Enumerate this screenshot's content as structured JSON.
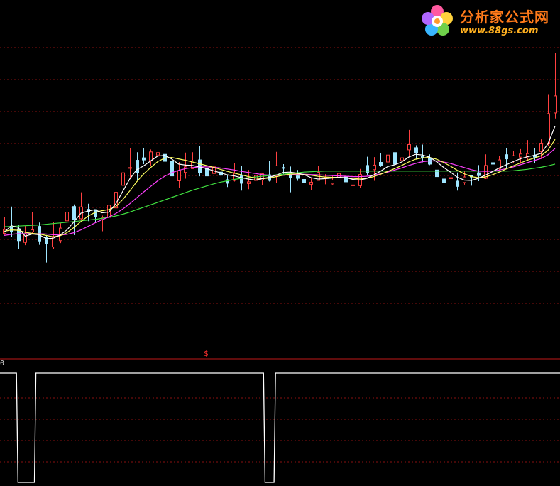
{
  "logo": {
    "title": "分析家公式网",
    "url": "www.88gs.com",
    "icon": "flower-logo-icon"
  },
  "indicator_panel": {
    "signal_mark": "$",
    "left_label": "0"
  },
  "colors": {
    "background": "#000000",
    "grid": "#8a1010",
    "separator": "#c01818",
    "up_candle": "#ff4040",
    "down_candle": "#9fe6ff",
    "ma_short": "#ffffff",
    "ma_mid": "#ffff60",
    "ma_long": "#ff40ff",
    "ma_longest": "#40e040",
    "indicator_line": "#ffffff"
  },
  "chart_data": [
    {
      "type": "candlestick",
      "title": "",
      "ylabel": "",
      "ylim": [
        0,
        100
      ],
      "grid": true,
      "candles": [
        [
          34.6,
          35.7,
          39.4,
          34.2
        ],
        [
          36.5,
          35.2,
          42.3,
          33.5
        ],
        [
          35.9,
          32.5,
          37.0,
          30.1
        ],
        [
          32.0,
          34.4,
          36.7,
          31.2
        ],
        [
          35.0,
          35.6,
          40.7,
          34.5
        ],
        [
          36.6,
          32.4,
          37.7,
          31.3
        ],
        [
          33.5,
          31.7,
          34.1,
          26.2
        ],
        [
          30.7,
          33.6,
          37.9,
          30.0
        ],
        [
          32.5,
          36.1,
          37.5,
          31.8
        ],
        [
          38.2,
          40.7,
          41.9,
          37.0
        ],
        [
          42.3,
          38.6,
          42.9,
          34.1
        ],
        [
          38.8,
          42.2,
          46.4,
          38.5
        ],
        [
          41.5,
          40.9,
          43.1,
          38.1
        ],
        [
          41.4,
          39.4,
          41.5,
          37.9
        ],
        [
          38.6,
          39.2,
          39.7,
          35.2
        ],
        [
          39.2,
          42.7,
          48.2,
          37.9
        ],
        [
          41.9,
          46.4,
          55.1,
          41.3
        ],
        [
          48.4,
          52.0,
          58.2,
          47.2
        ],
        [
          53.5,
          53.5,
          59.0,
          50.2
        ],
        [
          55.6,
          52.0,
          57.9,
          50.0
        ],
        [
          56.3,
          55.7,
          59.1,
          54.5
        ],
        [
          55.4,
          58.0,
          58.7,
          54.0
        ],
        [
          57.1,
          57.8,
          62.8,
          52.9
        ],
        [
          57.3,
          55.3,
          58.2,
          52.3
        ],
        [
          55.3,
          51.1,
          57.8,
          49.6
        ],
        [
          49.7,
          52.6,
          55.1,
          47.6
        ],
        [
          52.1,
          53.7,
          57.8,
          50.3
        ],
        [
          53.2,
          55.4,
          57.9,
          53.1
        ],
        [
          55.7,
          52.0,
          59.6,
          51.0
        ],
        [
          53.3,
          51.1,
          56.8,
          49.6
        ],
        [
          51.8,
          53.7,
          56.0,
          51.1
        ],
        [
          52.2,
          51.3,
          54.9,
          49.7
        ],
        [
          50.0,
          49.0,
          51.3,
          47.9
        ],
        [
          49.8,
          51.8,
          54.7,
          49.5
        ],
        [
          51.1,
          49.0,
          54.0,
          46.9
        ],
        [
          48.9,
          49.4,
          52.8,
          47.3
        ],
        [
          49.8,
          51.2,
          51.2,
          47.9
        ],
        [
          49.9,
          51.7,
          51.8,
          48.5
        ],
        [
          51.4,
          49.8,
          55.5,
          49.5
        ],
        [
          51.0,
          54.0,
          58.0,
          49.0
        ],
        [
          53.5,
          53.4,
          54.5,
          51.7
        ],
        [
          51.8,
          50.7,
          53.8,
          46.4
        ],
        [
          51.1,
          50.4,
          52.8,
          49.7
        ],
        [
          50.1,
          49.2,
          51.5,
          47.3
        ],
        [
          48.7,
          49.3,
          50.5,
          47.0
        ],
        [
          49.8,
          52.1,
          53.9,
          49.7
        ],
        [
          50.7,
          50.7,
          51.6,
          48.7
        ],
        [
          48.8,
          49.9,
          51.1,
          48.6
        ],
        [
          50.7,
          51.8,
          53.3,
          50.5
        ],
        [
          50.9,
          49.4,
          52.7,
          47.6
        ],
        [
          48.3,
          48.5,
          50.4,
          46.3
        ],
        [
          48.3,
          51.5,
          53.1,
          47.6
        ],
        [
          54.1,
          52.1,
          56.6,
          51.2
        ],
        [
          52.9,
          54.2,
          56.5,
          49.7
        ],
        [
          55.0,
          54.0,
          57.7,
          53.7
        ],
        [
          55.1,
          57.1,
          61.1,
          54.5
        ],
        [
          57.8,
          54.5,
          57.8,
          53.5
        ],
        [
          55.5,
          56.3,
          58.7,
          55.3
        ],
        [
          58.6,
          60.1,
          64.3,
          56.6
        ],
        [
          59.2,
          57.8,
          59.9,
          55.8
        ],
        [
          56.8,
          56.4,
          60.1,
          55.0
        ],
        [
          56.3,
          54.5,
          57.3,
          54.2
        ],
        [
          52.8,
          50.9,
          55.3,
          47.9
        ],
        [
          50.2,
          49.1,
          51.2,
          46.8
        ],
        [
          50.3,
          50.6,
          53.7,
          47.0
        ],
        [
          49.6,
          48.1,
          52.1,
          46.9
        ],
        [
          49.2,
          50.8,
          52.5,
          48.6
        ],
        [
          51.3,
          50.8,
          51.1,
          48.3
        ],
        [
          52.0,
          51.2,
          54.2,
          49.6
        ],
        [
          50.4,
          54.1,
          57.3,
          50.2
        ],
        [
          54.9,
          54.5,
          55.8,
          52.6
        ],
        [
          53.2,
          55.7,
          56.9,
          52.8
        ],
        [
          57.2,
          56.0,
          59.1,
          53.1
        ],
        [
          55.4,
          56.9,
          58.3,
          54.8
        ],
        [
          56.5,
          57.4,
          58.8,
          54.6
        ],
        [
          56.3,
          57.5,
          61.4,
          55.5
        ],
        [
          57.0,
          56.5,
          59.1,
          54.8
        ],
        [
          58.1,
          60.5,
          61.6,
          56.0
        ],
        [
          60.5,
          69.0,
          74.6,
          59.6
        ],
        [
          69.2,
          74.1,
          86.5,
          67.6
        ]
      ],
      "moving_averages": {
        "ma_short": [
          34.9,
          36.8,
          36.3,
          33.8,
          34.4,
          34.2,
          33.1,
          33.2,
          34.1,
          35.6,
          37.9,
          40.4,
          41.0,
          41.4,
          40.5,
          40.7,
          43.1,
          46.7,
          50.2,
          52.9,
          54.0,
          55.4,
          56.8,
          57.0,
          56.0,
          54.5,
          54.2,
          54.1,
          53.7,
          53.2,
          52.6,
          52.0,
          51.4,
          51.1,
          50.6,
          50.2,
          49.9,
          50.3,
          50.7,
          51.3,
          52.1,
          52.2,
          51.9,
          51.5,
          50.6,
          50.2,
          50.3,
          50.5,
          50.7,
          50.6,
          50.1,
          49.9,
          50.4,
          51.4,
          52.5,
          53.8,
          54.3,
          55.1,
          56.5,
          57.3,
          57.1,
          56.5,
          55.2,
          53.6,
          52.2,
          50.7,
          49.9,
          49.8,
          50.4,
          51.3,
          52.3,
          53.4,
          54.3,
          55.2,
          56.0,
          56.6,
          57.0,
          57.6,
          60.4,
          65.4
        ],
        "ma_mid": [
          35.2,
          35.6,
          35.5,
          34.9,
          34.6,
          34.4,
          34.0,
          33.6,
          33.9,
          34.8,
          36.3,
          38.0,
          39.5,
          40.6,
          41.1,
          41.4,
          42.3,
          44.3,
          46.8,
          49.4,
          51.7,
          53.5,
          55.2,
          56.2,
          56.4,
          56.0,
          55.6,
          55.1,
          54.6,
          54.1,
          53.6,
          53.0,
          52.4,
          51.9,
          51.4,
          50.9,
          50.5,
          50.3,
          50.5,
          50.9,
          51.3,
          51.6,
          51.7,
          51.5,
          51.3,
          51.0,
          50.8,
          50.7,
          50.7,
          50.6,
          50.4,
          50.2,
          50.4,
          50.9,
          51.6,
          52.4,
          53.2,
          54.1,
          55.1,
          55.9,
          56.3,
          56.4,
          55.9,
          55.0,
          53.9,
          52.7,
          51.7,
          50.9,
          50.6,
          50.8,
          51.4,
          52.2,
          53.1,
          54.0,
          54.8,
          55.6,
          56.2,
          56.9,
          58.5,
          61.6
        ],
        "ma_long": [
          34.0,
          34.3,
          34.5,
          34.5,
          34.5,
          34.5,
          34.4,
          34.2,
          34.1,
          34.3,
          34.8,
          35.6,
          36.6,
          37.6,
          38.5,
          39.3,
          40.3,
          41.6,
          43.1,
          44.8,
          46.5,
          48.1,
          49.7,
          51.0,
          52.0,
          52.7,
          53.2,
          53.5,
          53.7,
          53.7,
          53.6,
          53.4,
          53.1,
          52.8,
          52.4,
          52.1,
          51.8,
          51.5,
          51.3,
          51.3,
          51.3,
          51.4,
          51.5,
          51.6,
          51.5,
          51.4,
          51.3,
          51.2,
          51.1,
          51.0,
          50.9,
          50.9,
          51.0,
          51.3,
          51.7,
          52.2,
          52.8,
          53.4,
          54.1,
          54.7,
          55.2,
          55.4,
          55.4,
          55.1,
          54.7,
          54.1,
          53.5,
          52.9,
          52.5,
          52.4,
          52.5,
          52.8,
          53.2,
          53.7,
          54.3,
          54.9,
          55.5,
          56.1,
          57.2,
          59.0
        ],
        "ma_longest": [
          36.5,
          36.6,
          36.7,
          36.8,
          36.9,
          37.0,
          37.2,
          37.4,
          37.6,
          37.8,
          38.0,
          38.2,
          38.4,
          38.6,
          38.9,
          39.2,
          39.6,
          40.1,
          40.7,
          41.4,
          42.1,
          42.8,
          43.5,
          44.2,
          44.9,
          45.6,
          46.3,
          47.0,
          47.6,
          48.2,
          48.8,
          49.3,
          49.7,
          50.1,
          50.4,
          50.6,
          50.8,
          51.0,
          51.2,
          51.4,
          51.6,
          51.8,
          52.0,
          52.2,
          52.3,
          52.4,
          52.5,
          52.5,
          52.5,
          52.5,
          52.5,
          52.5,
          52.5,
          52.5,
          52.5,
          52.5,
          52.5,
          52.5,
          52.5,
          52.5,
          52.5,
          52.5,
          52.5,
          52.5,
          52.5,
          52.5,
          52.5,
          52.5,
          52.5,
          52.5,
          52.5,
          52.5,
          52.5,
          52.6,
          52.8,
          53.0,
          53.3,
          53.6,
          54.0,
          54.5
        ]
      }
    },
    {
      "type": "line",
      "title": "",
      "ylim": [
        0,
        1
      ],
      "values": [
        1,
        1,
        1,
        1,
        1,
        1,
        1,
        1,
        1,
        1,
        1,
        1,
        0,
        0,
        0,
        0,
        0,
        0,
        0,
        0,
        0,
        0,
        0,
        0,
        1,
        1,
        1,
        1,
        1,
        1,
        1,
        1,
        1,
        1,
        1,
        1,
        1,
        1,
        1,
        1,
        1,
        1,
        1,
        1,
        1,
        1,
        1,
        1,
        1,
        1,
        1,
        1,
        1,
        1,
        1,
        1,
        1,
        1,
        1,
        1,
        1,
        1,
        1,
        1,
        1,
        1,
        1,
        1,
        1,
        1,
        1,
        1,
        1,
        1,
        1,
        1,
        1,
        1,
        1,
        1,
        1,
        1,
        1,
        1,
        1,
        1,
        1,
        1,
        1,
        1,
        1,
        1,
        1,
        1,
        1,
        1,
        1,
        1,
        1,
        1,
        1,
        1,
        1,
        1,
        1,
        1,
        1,
        1,
        1,
        1,
        1,
        1,
        1,
        1,
        1,
        1,
        1,
        1,
        1,
        1,
        1,
        1,
        1,
        1,
        1,
        1,
        1,
        1,
        1,
        1,
        1,
        1,
        1,
        1,
        1,
        1,
        1,
        1,
        1,
        1,
        1,
        1,
        1,
        1,
        1,
        1,
        1,
        1,
        1,
        1,
        1,
        1,
        1,
        1,
        1,
        1,
        1,
        1,
        1,
        1,
        1,
        1,
        1,
        1,
        1,
        1,
        1,
        1,
        1,
        1,
        1,
        1,
        1,
        1,
        1,
        1,
        1,
        0,
        0,
        0,
        0,
        0,
        0,
        0,
        1,
        1,
        1,
        1,
        1,
        1,
        1,
        1,
        1,
        1,
        1,
        1,
        1,
        1,
        1,
        1,
        1,
        1,
        1,
        1,
        1,
        1,
        1,
        1,
        1,
        1,
        1,
        1,
        1,
        1,
        1,
        1,
        1,
        1,
        1,
        1,
        1,
        1,
        1,
        1,
        1,
        1,
        1,
        1,
        1,
        1,
        1,
        1,
        1,
        1,
        1,
        1,
        1,
        1,
        1,
        1,
        1,
        1,
        1,
        1,
        1,
        1,
        1,
        1,
        1,
        1,
        1,
        1,
        1,
        1,
        1,
        1,
        1,
        1,
        1,
        1,
        1,
        1,
        1,
        1,
        1,
        1,
        1,
        1,
        1,
        1,
        1,
        1,
        1,
        1,
        1,
        1,
        1,
        1,
        1,
        1,
        1,
        1,
        1,
        1,
        1,
        1,
        1,
        1,
        1,
        1,
        1,
        1,
        1,
        1,
        1,
        1,
        1,
        1,
        1,
        1,
        1,
        1,
        1,
        1,
        1,
        1,
        1,
        1,
        1,
        1,
        1,
        1,
        1,
        1,
        1,
        1,
        1,
        1,
        1,
        1,
        1,
        1,
        1,
        1,
        1,
        1,
        1,
        1,
        1,
        1,
        1,
        1,
        1,
        1,
        1,
        1,
        1,
        1,
        1,
        1,
        1,
        1,
        1,
        1,
        1,
        1,
        1,
        1,
        1,
        1,
        1,
        1,
        1,
        1,
        1,
        1,
        1,
        1,
        1,
        1,
        1,
        1,
        1,
        1,
        1,
        1,
        1,
        1,
        1,
        1,
        1,
        1,
        1,
        1,
        1
      ]
    }
  ]
}
